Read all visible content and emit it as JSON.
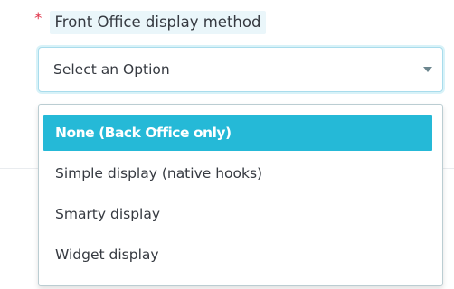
{
  "field": {
    "required_marker": "*",
    "label": "Front Office display method"
  },
  "select": {
    "value": "Select an Option",
    "caret_icon": "caret-down-icon",
    "options": [
      {
        "label": "None (Back Office only)",
        "highlighted": true
      },
      {
        "label": "Simple display (native hooks)",
        "highlighted": false
      },
      {
        "label": "Smarty display",
        "highlighted": false
      },
      {
        "label": "Widget display",
        "highlighted": false
      }
    ]
  },
  "colors": {
    "accent": "#25b9d7",
    "required": "#e0374d",
    "label_background": "#eaf6fa",
    "text": "#363a41"
  }
}
